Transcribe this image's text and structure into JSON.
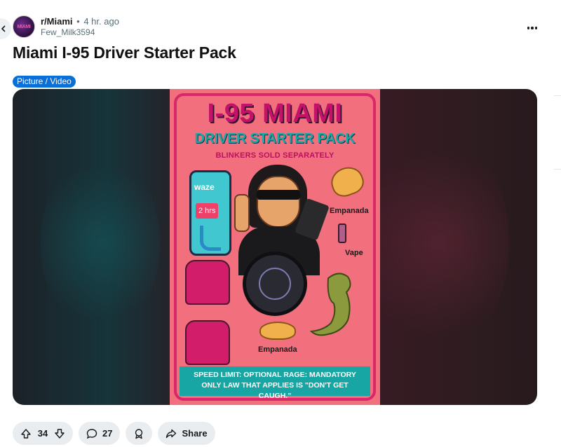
{
  "post": {
    "subreddit": "r/Miami",
    "separator": "•",
    "time_ago": "4 hr. ago",
    "author": "Few_Milk3594",
    "title": "Miami I-95 Driver Starter Pack",
    "flair": "Picture / Video",
    "flair_color": "#0a6fd6"
  },
  "image": {
    "title": "I-95 MIAMI",
    "subtitle": "DRIVER STARTER PACK",
    "tagline": "BLINKERS SOLD SEPARATELY",
    "app_name": "waze",
    "eta": "2 hrs",
    "label_empanada_1": "Empanada",
    "label_vape": "Vape",
    "label_empanada_2": "Empanada",
    "footer_line1": "SPEED LIMIT: OPTIONAL RAGE: MANDATORY",
    "footer_line2": "ONLY LAW THAT APPLIES IS \"DON'T GET CAUGH.\""
  },
  "actions": {
    "upvotes": "34",
    "comments": "27",
    "share_label": "Share"
  },
  "icons": {
    "back": "chevron-left-icon",
    "more": "more-horizontal-icon",
    "upvote": "arrow-up-icon",
    "downvote": "arrow-down-icon",
    "comment": "speech-bubble-icon",
    "award": "award-icon",
    "share": "share-arrow-icon"
  }
}
